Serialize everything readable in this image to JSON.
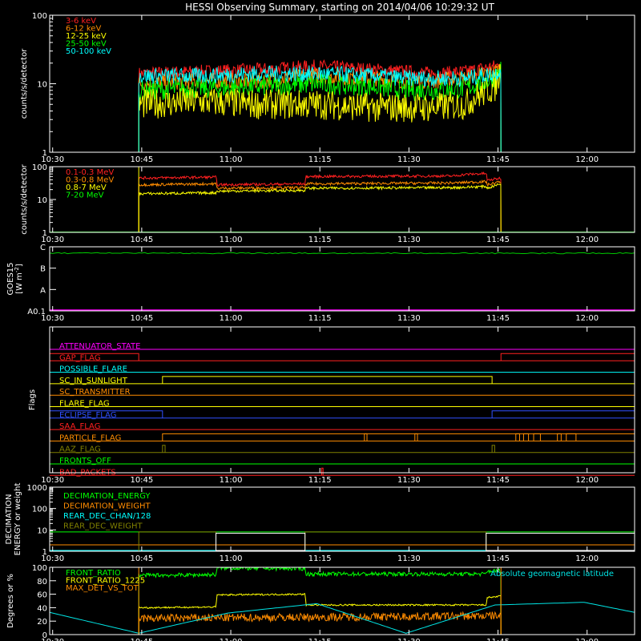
{
  "title": "HESSI Observing Summary, starting on 2014/04/06 10:29:32 UT",
  "time_axis": {
    "ticks": [
      "10:30",
      "10:45",
      "11:00",
      "11:15",
      "11:30",
      "11:45",
      "12:00"
    ],
    "tick_minutes": [
      0.5,
      15.5,
      30.5,
      45.5,
      60.5,
      75.5,
      90.5
    ],
    "range_minutes": [
      0,
      98.5
    ],
    "unit_note": "minutes after 10:29:32 UT"
  },
  "chart_data": [
    {
      "id": "lo-energy",
      "type": "line",
      "ylabel": "counts/s/detector",
      "yscale": "log",
      "ylim": [
        1,
        100
      ],
      "yticks": [
        "1",
        "10",
        "100"
      ],
      "grid": false,
      "legend_position": "top-left",
      "coverage": [
        15,
        76
      ],
      "series": [
        {
          "name": "3-6 keV",
          "color": "#ff2020",
          "x": [
            15,
            25,
            35,
            45,
            55,
            60,
            65,
            70,
            75,
            76
          ],
          "y": [
            14,
            15,
            16,
            18,
            16,
            15,
            14,
            15,
            18,
            19
          ],
          "noise": 0.1
        },
        {
          "name": "6-12 keV",
          "color": "#ff8c00",
          "x": [
            15,
            25,
            35,
            45,
            55,
            60,
            65,
            70,
            75,
            76
          ],
          "y": [
            10,
            11,
            11,
            13,
            12,
            11,
            11,
            12,
            15,
            17
          ],
          "noise": 0.12
        },
        {
          "name": "12-25 keV",
          "color": "#ffff00",
          "x": [
            15,
            25,
            35,
            45,
            55,
            60,
            65,
            70,
            75,
            76
          ],
          "y": [
            5,
            5.5,
            5,
            5,
            4.5,
            4.5,
            4.5,
            5,
            9,
            15
          ],
          "noise": 0.22
        },
        {
          "name": "25-50 keV",
          "color": "#00ff00",
          "x": [
            15,
            25,
            35,
            45,
            55,
            60,
            65,
            70,
            75,
            76
          ],
          "y": [
            8,
            8.5,
            9,
            10,
            9,
            8,
            8,
            8.5,
            12,
            16
          ],
          "noise": 0.15
        },
        {
          "name": "50-100 keV",
          "color": "#00ffff",
          "x": [
            15,
            25,
            35,
            45,
            55,
            60,
            65,
            70,
            75,
            76
          ],
          "y": [
            13,
            13,
            14,
            14,
            13,
            12,
            12,
            12,
            14,
            16
          ],
          "noise": 0.12
        }
      ]
    },
    {
      "id": "hi-energy",
      "type": "line",
      "ylabel": "counts/s/detector",
      "yscale": "log",
      "ylim": [
        1,
        100
      ],
      "yticks": [
        "1",
        "10",
        "100"
      ],
      "grid": false,
      "legend_position": "top-left",
      "coverage": [
        15,
        76
      ],
      "series": [
        {
          "name": "0.1-0.3 MeV",
          "color": "#ff2020",
          "x": [
            15,
            28,
            28.2,
            43,
            43.2,
            68,
            70,
            73.5,
            73.7,
            76
          ],
          "y": [
            45,
            48,
            28,
            30,
            50,
            52,
            58,
            62,
            38,
            45
          ],
          "noise": 0.04
        },
        {
          "name": "0.3-0.8 MeV",
          "color": "#ff8c00",
          "x": [
            15,
            28,
            28.2,
            43,
            43.2,
            68,
            73.5,
            73.7,
            76
          ],
          "y": [
            28,
            30,
            22,
            23,
            30,
            32,
            35,
            28,
            35
          ],
          "noise": 0.04
        },
        {
          "name": "0.8-7 MeV",
          "color": "#ffff00",
          "x": [
            15,
            28,
            28.2,
            43,
            43.2,
            68,
            73.5,
            73.7,
            76
          ],
          "y": [
            15,
            16,
            18,
            19,
            22,
            23,
            25,
            22,
            30
          ],
          "noise": 0.04
        },
        {
          "name": "7-20 MeV",
          "color": "#00ff00",
          "x": [
            0,
            98.5
          ],
          "y": [
            1.02,
            1.02
          ],
          "noise": 0
        }
      ]
    },
    {
      "id": "goes",
      "type": "line",
      "ylabel": "GOES15",
      "ylabel_unit": "[W m",
      "ylabel_unit_sup": "-2",
      "ylabel_unit_close": "]",
      "yticks": [
        "A0.1",
        "A",
        "B",
        "C"
      ],
      "grid": false,
      "series": [
        {
          "name": "GOES15",
          "color": "#00cc00",
          "level": "C",
          "y_frac": 0.9
        },
        {
          "name": "baseline",
          "color": "#ff00ff",
          "level": "A0.1",
          "y_frac": 0.0
        }
      ]
    },
    {
      "id": "flags",
      "type": "line",
      "ylabel": "Flags",
      "grid": false,
      "rows": [
        {
          "name": "ATTENUATOR_STATE",
          "color": "#ff00ff",
          "segments": []
        },
        {
          "name": "GAP_FLAG",
          "color": "#ff2020",
          "segments": [
            [
              0,
              15
            ],
            [
              76,
              98.5
            ]
          ]
        },
        {
          "name": "POSSIBLE_FLARE",
          "color": "#00ffff",
          "segments": []
        },
        {
          "name": "SC_IN_SUNLIGHT",
          "color": "#ffff00",
          "segments": [
            [
              19,
              74.5
            ]
          ]
        },
        {
          "name": "SC_TRANSMITTER",
          "color": "#ff8c00",
          "segments": []
        },
        {
          "name": "FLARE_FLAG",
          "color": "#ffff00",
          "segments": []
        },
        {
          "name": "ECLIPSE_FLAG",
          "color": "#3050ff",
          "segments": [
            [
              0,
              19
            ],
            [
              74.5,
              98.5
            ]
          ]
        },
        {
          "name": "SAA_FLAG",
          "color": "#ff2020",
          "segments": []
        },
        {
          "name": "PARTICLE_FLAG",
          "color": "#ff8c00",
          "segments": [
            [
              19,
              98.5
            ]
          ],
          "spikes": [
            [
              53,
              53.3
            ],
            [
              61.5,
              61.8
            ],
            [
              78.5,
              79
            ],
            [
              79.8,
              80.5
            ],
            [
              81.5,
              82.5
            ],
            [
              85.5,
              86
            ],
            [
              87,
              88.5
            ]
          ]
        },
        {
          "name": "AAZ_FLAG",
          "color": "#808000",
          "segments": [],
          "spikes": [
            [
              19,
              19.3
            ],
            [
              74.5,
              74.8
            ]
          ]
        },
        {
          "name": "FRONTS_OFF",
          "color": "#00ff00",
          "segments": []
        },
        {
          "name": "BAD_PACKETS",
          "color": "#ff2020",
          "segments": [],
          "spikes": [
            [
              45.8,
              45.9
            ]
          ]
        }
      ]
    },
    {
      "id": "decimation",
      "type": "line",
      "ylabel": "DECIMATION",
      "ylabel2": "ENERGY or weight",
      "yscale": "log",
      "ylim": [
        1,
        1000
      ],
      "yticks": [
        "1",
        "10",
        "100",
        "1000"
      ],
      "grid": false,
      "legend_position": "top-left",
      "series": [
        {
          "name": "DECIMATION_ENERGY",
          "color": "#00ff00",
          "x": [
            0,
            98.5
          ],
          "y": [
            1,
            1
          ]
        },
        {
          "name": "DECIMATION_WEIGHT",
          "color": "#ff8c00",
          "x": [
            0,
            98.5
          ],
          "y": [
            2,
            2
          ]
        },
        {
          "name": "REAR_DEC_CHAN/128",
          "color": "#00ffff",
          "x": [
            0,
            98.5
          ],
          "y": [
            1,
            1
          ]
        },
        {
          "name": "REAR_DEC_WEIGHT",
          "color": "#808000",
          "x": [
            15,
            15,
            28,
            28,
            43,
            43,
            73.5,
            73.5,
            98.5
          ],
          "y": [
            1,
            8,
            8,
            1,
            1,
            8,
            8,
            1,
            1
          ]
        }
      ],
      "boxes": [
        {
          "x": [
            0,
            98.5
          ],
          "y": [
            8,
            8
          ],
          "color": "#00ff00"
        },
        {
          "x": [
            28,
            43
          ],
          "y": [
            1,
            7
          ],
          "color": "#ffffff"
        },
        {
          "x": [
            73.5,
            98.5
          ],
          "y": [
            1,
            7
          ],
          "color": "#ffffff"
        }
      ]
    },
    {
      "id": "ratio",
      "type": "line",
      "ylabel": "Degrees or %",
      "ylim": [
        0,
        100
      ],
      "yticks": [
        "0",
        "20",
        "40",
        "60",
        "80",
        "100"
      ],
      "grid": false,
      "legend_position": "top-left",
      "coverage": [
        15,
        76
      ],
      "series": [
        {
          "name": "FRONT_RATIO",
          "color": "#00ff00",
          "x": [
            15,
            28,
            28.2,
            43,
            43.2,
            73.5,
            73.7,
            76
          ],
          "y": [
            88,
            89,
            99,
            98,
            90,
            90,
            94,
            95
          ],
          "noise": 3
        },
        {
          "name": "FRONT_RATIO_1225",
          "color": "#ffff00",
          "x": [
            15,
            28,
            28.2,
            43,
            43.2,
            73.5,
            73.7,
            76
          ],
          "y": [
            40,
            41,
            59,
            60,
            44,
            44,
            55,
            57
          ],
          "noise": 1.2
        },
        {
          "name": "MAX_DET_VS_TOT",
          "color": "#ff8c00",
          "x": [
            15,
            76
          ],
          "y": [
            24,
            28
          ],
          "noise": 6
        },
        {
          "name": "Absolute geomagnetic latitude",
          "color": "#00e5e5",
          "x": [
            0,
            15,
            30,
            45,
            60,
            75,
            90,
            98.5
          ],
          "y": [
            33,
            2,
            32,
            46,
            2,
            44,
            48,
            33
          ],
          "noise": 0,
          "smooth": true
        }
      ]
    }
  ]
}
